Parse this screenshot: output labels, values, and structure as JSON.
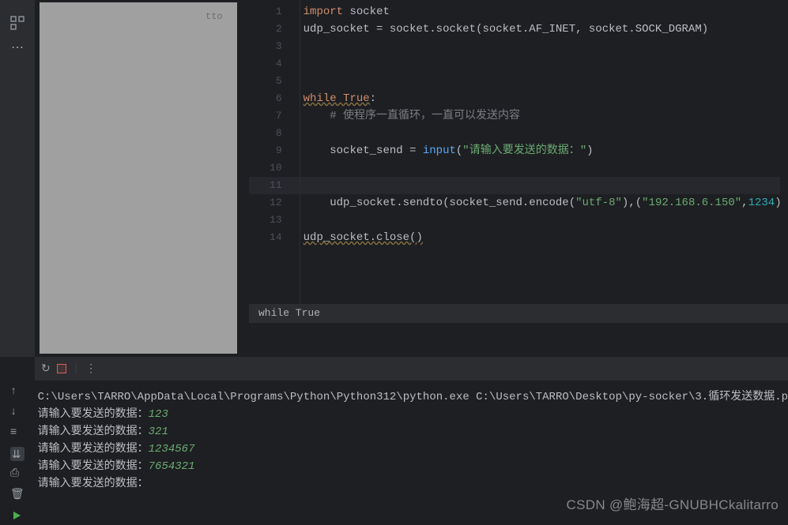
{
  "leftbar": {
    "icon1": "structure-icon",
    "icon2": "more-icon"
  },
  "gutter": {
    "lines": [
      "1",
      "2",
      "3",
      "4",
      "5",
      "6",
      "7",
      "8",
      "9",
      "10",
      "11",
      "12",
      "13",
      "14"
    ]
  },
  "code": {
    "line1_kw": "import",
    "line1_id": " socket",
    "line2": "udp_socket = socket.socket(socket.AF_INET, socket.SOCK_DGRAM)",
    "line6_kw": "while True",
    "line6_colon": ":",
    "line7_cmt": "    # 使程序一直循环，一直可以发送内容",
    "line9_pre": "    socket_send = ",
    "line9_fn": "input",
    "line9_open": "(",
    "line9_str": "\"请输入要发送的数据：\"",
    "line9_close": ")",
    "line12_pre": "    udp_socket.sendto(socket_send.encode(",
    "line12_str1": "\"utf-8\"",
    "line12_mid": "),(",
    "line12_str2": "\"192.168.6.150\"",
    "line12_comma": ",",
    "line12_num": "1234",
    "line12_close": "))",
    "line14": "udp_socket.close()"
  },
  "breadcrumb": {
    "text": "while True"
  },
  "file_hint": "tto",
  "terminal": {
    "cmd": "C:\\Users\\TARRO\\AppData\\Local\\Programs\\Python\\Python312\\python.exe C:\\Users\\TARRO\\Desktop\\py-socker\\3.循环发送数据.p",
    "prompt": "请输入要发送的数据：",
    "inputs": [
      "123",
      "321",
      "1234567",
      "7654321"
    ],
    "cursor": "|"
  },
  "term_toolbar": {
    "rerun": "↻",
    "more": "⋮"
  },
  "side_icons": {
    "up": "↑",
    "down": "↓",
    "wrap": "≡",
    "scroll": "⇊",
    "print": "⎙",
    "trash": "🗑"
  },
  "watermark": "CSDN @鲍海超-GNUBHCkalitarro"
}
